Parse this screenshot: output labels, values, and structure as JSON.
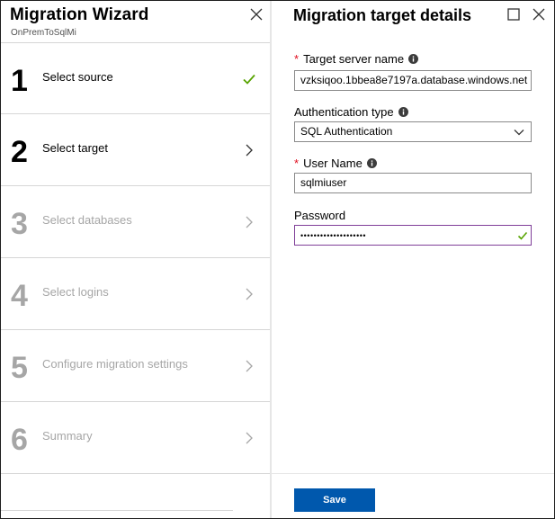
{
  "wizard": {
    "title": "Migration Wizard",
    "subtitle": "OnPremToSqlMi",
    "steps": [
      {
        "number": "1",
        "label": "Select source",
        "state": "completed",
        "icon": "checkmark-icon"
      },
      {
        "number": "2",
        "label": "Select target",
        "state": "active",
        "icon": "chevron-right-icon"
      },
      {
        "number": "3",
        "label": "Select databases",
        "state": "disabled",
        "icon": "chevron-right-icon"
      },
      {
        "number": "4",
        "label": "Select logins",
        "state": "disabled",
        "icon": "chevron-right-icon"
      },
      {
        "number": "5",
        "label": "Configure migration settings",
        "state": "disabled",
        "icon": "chevron-right-icon"
      },
      {
        "number": "6",
        "label": "Summary",
        "state": "disabled",
        "icon": "chevron-right-icon"
      }
    ]
  },
  "target": {
    "title": "Migration target details",
    "server_name": {
      "label": "Target server name",
      "required": true,
      "value": "vzksiqoo.1bbea8e7197a.database.windows.net"
    },
    "auth_type": {
      "label": "Authentication type",
      "value": "SQL Authentication"
    },
    "user_name": {
      "label": "User Name",
      "required": true,
      "value": "sqlmiuser"
    },
    "password": {
      "label": "Password",
      "value": "••••••••••••••••••••",
      "valid": true
    },
    "save_label": "Save"
  },
  "colors": {
    "accent": "#0058ad",
    "success": "#57a300",
    "required": "#e00b1c",
    "focus_border": "#7f3f98"
  }
}
